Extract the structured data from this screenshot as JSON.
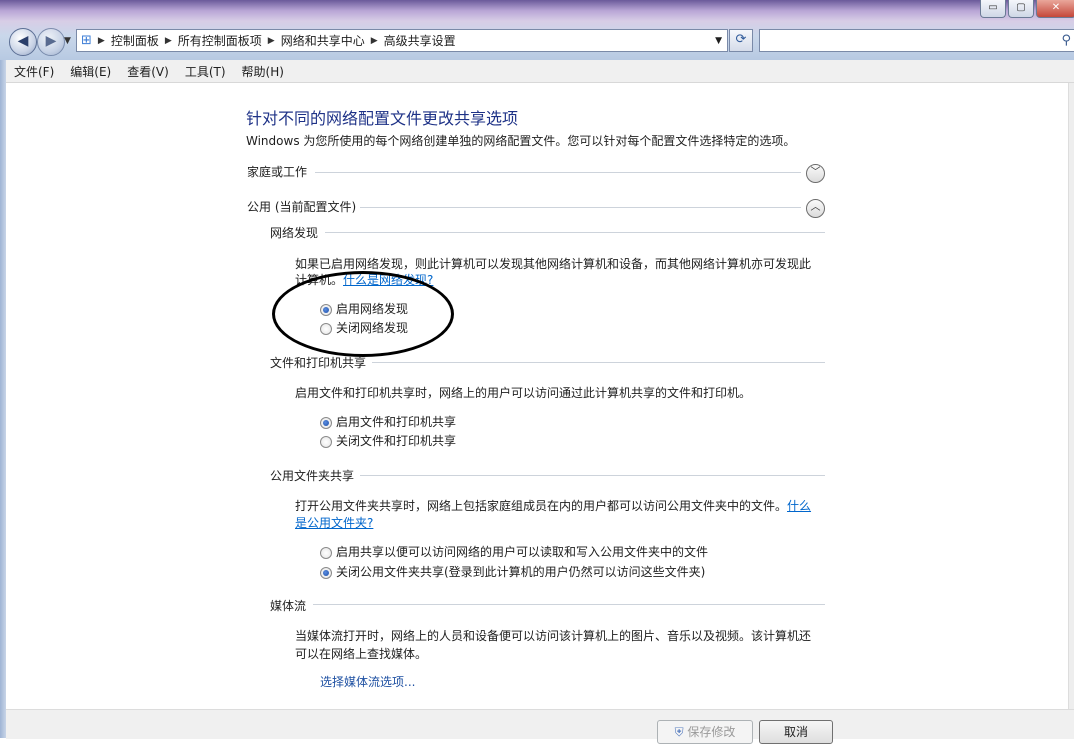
{
  "window": {
    "controls": {
      "minimize": "▭",
      "maximize": "▢",
      "close": "✕"
    }
  },
  "nav": {
    "back_icon": "back-arrow-icon",
    "forward_icon": "forward-arrow-icon",
    "breadcrumbs": [
      "控制面板",
      "所有控制面板项",
      "网络和共享中心",
      "高级共享设置"
    ],
    "search_placeholder": ""
  },
  "menubar": [
    "文件(F)",
    "编辑(E)",
    "查看(V)",
    "工具(T)",
    "帮助(H)"
  ],
  "main": {
    "title": "针对不同的网络配置文件更改共享选项",
    "intro": "Windows 为您所使用的每个网络创建单独的网络配置文件。您可以针对每个配置文件选择特定的选项。",
    "profiles": [
      {
        "label": "家庭或工作",
        "expanded": false
      },
      {
        "label": "公用 (当前配置文件)",
        "expanded": true
      }
    ],
    "sections": {
      "discovery": {
        "title": "网络发现",
        "desc_line1": "如果已启用网络发现，则此计算机可以发现其他网络计算机和设备，而其他网络计算机亦可发现此",
        "desc_line2": "计算机。",
        "link": "什么是网络发现?",
        "options": [
          "启用网络发现",
          "关闭网络发现"
        ],
        "selected": 0
      },
      "file_printer": {
        "title": "文件和打印机共享",
        "desc": "启用文件和打印机共享时，网络上的用户可以访问通过此计算机共享的文件和打印机。",
        "options": [
          "启用文件和打印机共享",
          "关闭文件和打印机共享"
        ],
        "selected": 0
      },
      "public_folder": {
        "title": "公用文件夹共享",
        "desc": "打开公用文件夹共享时，网络上包括家庭组成员在内的用户都可以访问公用文件夹中的文件。",
        "link_part1": "什么",
        "link_part2": "是公用文件夹?",
        "options": [
          "启用共享以便可以访问网络的用户可以读取和写入公用文件夹中的文件",
          "关闭公用文件夹共享(登录到此计算机的用户仍然可以访问这些文件夹)"
        ],
        "selected": 1
      },
      "media": {
        "title": "媒体流",
        "desc_line1": "当媒体流打开时，网络上的人员和设备便可以访问该计算机上的图片、音乐以及视频。该计算机还",
        "desc_line2": "可以在网络上查找媒体。",
        "link": "选择媒体流选项..."
      }
    }
  },
  "footer": {
    "save": "保存修改",
    "cancel": "取消"
  },
  "colors": {
    "title": "#1e3287",
    "link": "#0066cc",
    "radio_on": "#1d4ea8"
  }
}
